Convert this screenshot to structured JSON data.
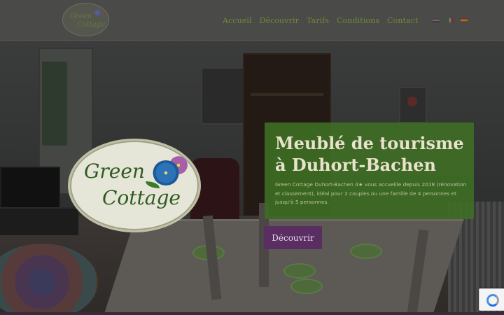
{
  "header": {
    "logo": {
      "text_line1": "Green",
      "text_line2": "Cottage"
    },
    "nav": [
      {
        "label": "Accueil"
      },
      {
        "label": "Découvrir"
      },
      {
        "label": "Tarifs"
      },
      {
        "label": "Conditions"
      },
      {
        "label": "Contact"
      }
    ],
    "languages": [
      {
        "code": "en",
        "icon": "uk-flag-icon"
      },
      {
        "code": "it",
        "icon": "italy-flag-icon"
      },
      {
        "code": "es",
        "icon": "spain-flag-icon"
      }
    ]
  },
  "hero": {
    "logo": {
      "text_line1": "Green",
      "text_line2": "Cottage"
    },
    "title": "Meublé de tourisme à Duhort-Bachen",
    "description": "Green Cottage Duhort-Bachen 4★ vous accueille depuis 2018 (rénovation et classement), idéal pour 2 couples ou une famille de 4 personnes et jusqu'à 5 personnes.",
    "cta_label": "Découvrir"
  },
  "colors": {
    "accent_green": "#3e6c24",
    "button_purple": "#5a2e62",
    "nav_green": "#6f8a3a"
  },
  "badge": {
    "icon": "recaptcha-icon"
  }
}
